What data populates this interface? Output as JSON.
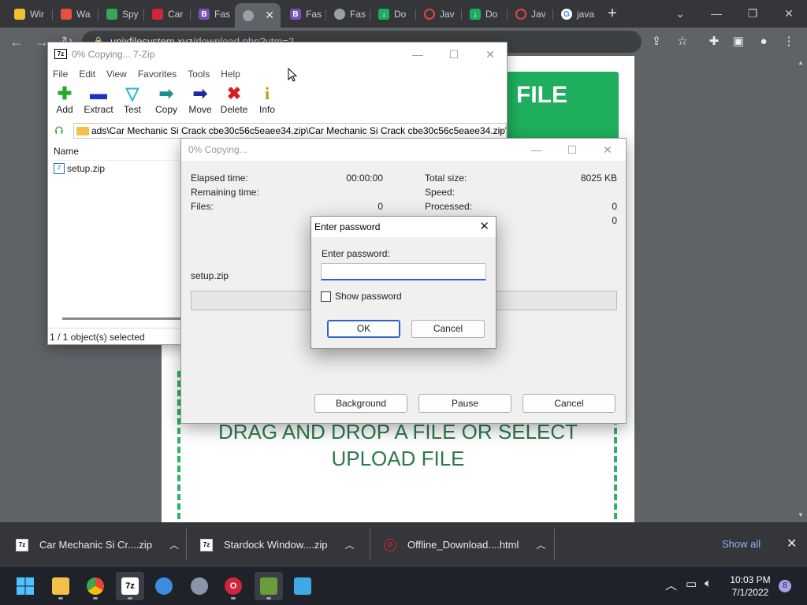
{
  "browser": {
    "tabs": [
      {
        "label": "Wir",
        "color": "#f2c12e"
      },
      {
        "label": "Wa",
        "color": "#e94f3c"
      },
      {
        "label": "Spy",
        "color": "#34a853"
      },
      {
        "label": "Car",
        "color": "#d4243b"
      },
      {
        "label": "Fas",
        "color": "#7952b3",
        "glyph": "B"
      },
      {
        "label": "",
        "color": "#9aa0a6"
      },
      {
        "label": "Fas",
        "color": "#7952b3",
        "glyph": "B"
      },
      {
        "label": "Fas",
        "color": "#9aa0a6"
      },
      {
        "label": "Do",
        "color": "#1fae5e"
      },
      {
        "label": "Jav",
        "color": "#e04444"
      },
      {
        "label": "Do",
        "color": "#1fae5e"
      },
      {
        "label": "Jav",
        "color": "#e04444"
      },
      {
        "label": "java",
        "color": "#4285f4",
        "glyph": "G"
      }
    ],
    "new_tab": "+",
    "address": {
      "host": "unixfilesystem.xyz",
      "path": "/download.php?utm=2"
    }
  },
  "page": {
    "button_label": "FILE",
    "drop_text_line1": "DRAG AND DROP A FILE OR SELECT",
    "drop_text_line2": "UPLOAD FILE",
    "accent": "#1fae5e"
  },
  "downloads": {
    "items": [
      {
        "name": "Car Mechanic Si Cr....zip"
      },
      {
        "name": "Stardock Window....zip"
      },
      {
        "name": "Offline_Download....html"
      }
    ],
    "show_all": "Show all"
  },
  "taskbar": {
    "time": "10:03 PM",
    "date": "7/1/2022",
    "notifications": "8"
  },
  "sevenzip": {
    "title": "0% Copying... 7-Zip",
    "logo": "7z",
    "menu": [
      "File",
      "Edit",
      "View",
      "Favorites",
      "Tools",
      "Help"
    ],
    "tools": [
      {
        "label": "Add",
        "icon": "add-icon"
      },
      {
        "label": "Extract",
        "icon": "extract-icon"
      },
      {
        "label": "Test",
        "icon": "test-icon"
      },
      {
        "label": "Copy",
        "icon": "copy-icon"
      },
      {
        "label": "Move",
        "icon": "move-icon"
      },
      {
        "label": "Delete",
        "icon": "delete-icon"
      },
      {
        "label": "Info",
        "icon": "info-icon"
      }
    ],
    "path": "ads\\Car Mechanic Si Crack cbe30c56c5eaee34.zip\\Car Mechanic Si Crack cbe30c56c5eaee34.zip\\",
    "column_name": "Name",
    "files": [
      "setup.zip"
    ],
    "status": "1 / 1 object(s) selected"
  },
  "copying": {
    "title": "0% Copying...",
    "elapsed_label": "Elapsed time:",
    "elapsed_value": "00:00:00",
    "remaining_label": "Remaining time:",
    "files_label": "Files:",
    "files_value": "0",
    "total_size_label": "Total size:",
    "total_size_value": "8025 KB",
    "speed_label": "Speed:",
    "processed_label": "Processed:",
    "processed_value": "0",
    "extra_value": "0",
    "current_file": "setup.zip",
    "progress": 0,
    "buttons": {
      "background": "Background",
      "pause": "Pause",
      "cancel": "Cancel"
    }
  },
  "password": {
    "title": "Enter password",
    "label": "Enter password:",
    "value": "",
    "show_password": "Show password",
    "ok": "OK",
    "cancel": "Cancel"
  }
}
